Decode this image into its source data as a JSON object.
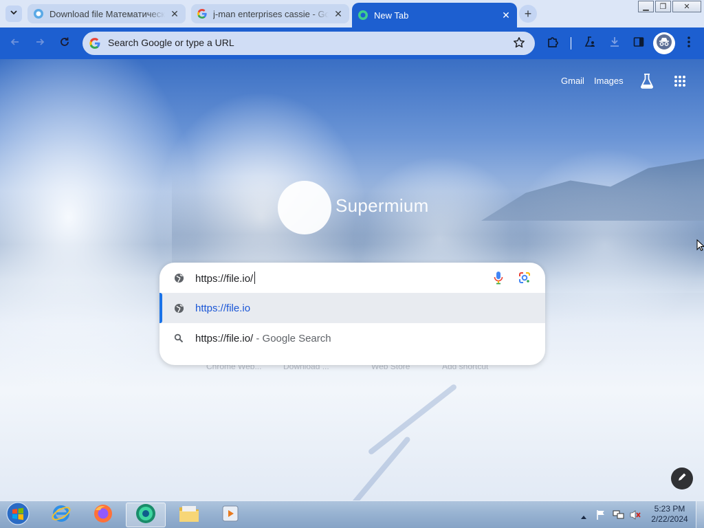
{
  "window": {
    "controls": {
      "minimize": "▁",
      "maximize": "❐",
      "close": "✕"
    }
  },
  "tabs": [
    {
      "title": "Download file Математическ",
      "favicon": "supermium-icon",
      "active": false
    },
    {
      "title": "j-man enterprises cassie - Goo",
      "favicon": "google-icon",
      "active": false
    },
    {
      "title": "New Tab",
      "favicon": "supermium-icon",
      "active": true
    }
  ],
  "toolbar": {
    "omnibox_placeholder": "Search Google or type a URL"
  },
  "ntp": {
    "links": {
      "gmail": "Gmail",
      "images": "Images"
    },
    "logo_text": "Supermium",
    "shortcuts": [
      "Chrome Web...",
      "Download ...",
      "Web Store",
      "Add shortcut"
    ]
  },
  "omnibox_dropdown": {
    "input_value": "https://file.io/",
    "suggestions": [
      {
        "text": "https://file.io",
        "description": "",
        "icon": "globe-icon",
        "selected": true
      },
      {
        "text": "https://file.io/",
        "description": " - Google Search",
        "icon": "search-icon",
        "selected": false
      }
    ]
  },
  "taskbar": {
    "clock_time": "5:23 PM",
    "clock_date": "2/22/2024",
    "apps": [
      "internet-explorer-icon",
      "firefox-icon",
      "supermium-icon",
      "file-explorer-icon",
      "media-player-icon"
    ]
  },
  "colors": {
    "toolbar": "#1d5fd0",
    "tabstrip": "#dce6f7",
    "accent_link": "#1a56d6"
  }
}
